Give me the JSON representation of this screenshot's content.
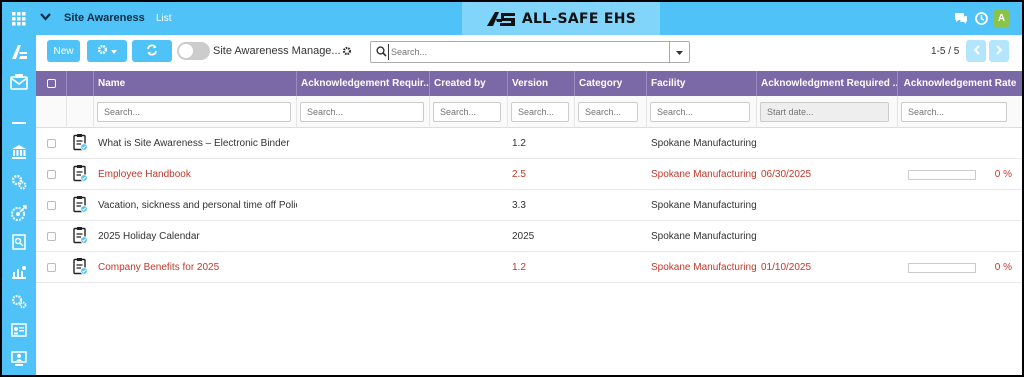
{
  "app": {
    "title": "Site Awareness",
    "view": "List",
    "brand": "ALL-SAFE EHS",
    "brand_mark": "AS",
    "user_initial": "A"
  },
  "toolbar": {
    "new_label": "New",
    "toggle_label": "Site Awareness Manage...",
    "search_placeholder": "Search...",
    "pagination": "1-5 / 5"
  },
  "columns": [
    "Name",
    "Acknowledgement Requir...",
    "Created by",
    "Version",
    "Category",
    "Facility",
    "Acknowledgment Required ...",
    "Acknowledgement Rate"
  ],
  "filters": {
    "search_placeholder": "Search...",
    "date_placeholder": "Start date..."
  },
  "rows": [
    {
      "name": "What is Site Awareness – Electronic Binder",
      "version": "1.2",
      "facility": "Spokane Manufacturing",
      "ack_date": "",
      "rate": "",
      "rate_value": 0,
      "highlight": false
    },
    {
      "name": "Employee Handbook",
      "version": "2.5",
      "facility": "Spokane Manufacturing",
      "ack_date": "06/30/2025",
      "rate": "0 %",
      "rate_value": 0,
      "highlight": true
    },
    {
      "name": "Vacation, sickness and personal time off Polici...",
      "version": "3.3",
      "facility": "Spokane Manufacturing",
      "ack_date": "",
      "rate": "",
      "rate_value": 0,
      "highlight": false
    },
    {
      "name": "2025 Holiday Calendar",
      "version": "2025",
      "facility": "Spokane Manufacturing",
      "ack_date": "",
      "rate": "",
      "rate_value": 0,
      "highlight": false
    },
    {
      "name": "Company Benefits for 2025",
      "version": "1.2",
      "facility": "Spokane Manufacturing",
      "ack_date": "01/10/2025",
      "rate": "0 %",
      "rate_value": 0,
      "highlight": true
    }
  ],
  "colors": {
    "accent": "#4fc3f7",
    "header": "#7b68a6",
    "highlight_text": "#c0392b",
    "avatar": "#8bc34a"
  },
  "icons": {
    "sidebar": [
      "apps-grid-icon",
      "logo-icon",
      "mail-icon",
      "divider-icon",
      "bank-icon",
      "gears-icon",
      "target-gear-icon",
      "report-icon",
      "people-chart-icon",
      "settings-icon",
      "id-card-icon",
      "monitor-user-icon"
    ],
    "row": "clipboard-check-icon"
  }
}
